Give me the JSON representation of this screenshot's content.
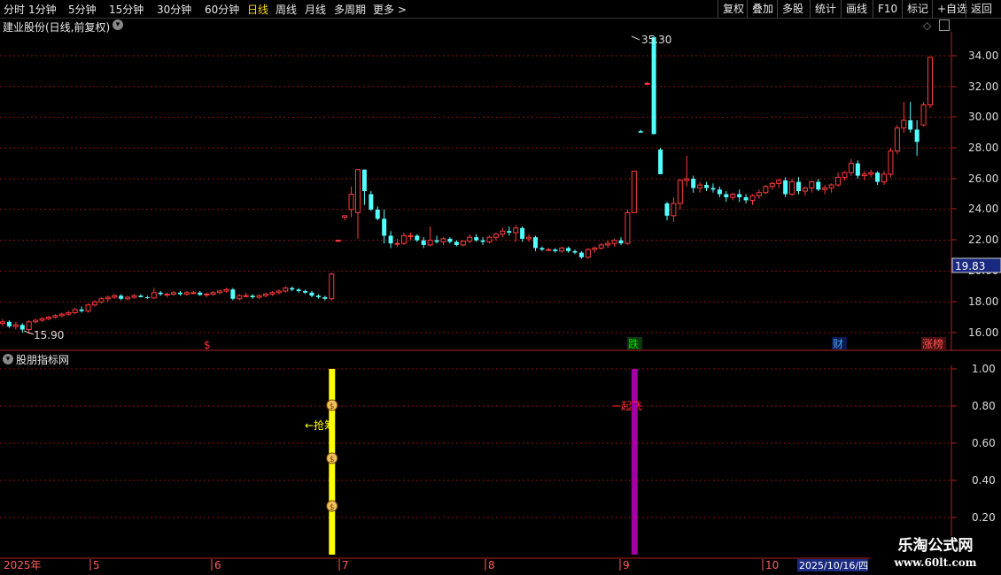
{
  "toolbar": {
    "periods": [
      "分时",
      "1分钟",
      "5分钟",
      "15分钟",
      "30分钟",
      "60分钟",
      "日线",
      "周线",
      "月线",
      "多周期",
      "更多 >"
    ],
    "active_period": "日线",
    "buttons": [
      "复权",
      "叠加",
      "多股",
      "统计",
      "画线",
      "F10",
      "标记",
      "+自选",
      "返回"
    ]
  },
  "header": {
    "title": "建业股份(日线,前复权)"
  },
  "price_axis": {
    "labels": [
      "34.00",
      "32.00",
      "30.00",
      "28.00",
      "26.00",
      "24.00",
      "22.00",
      "20.00",
      "18.00",
      "16.00"
    ],
    "current_price": "19.83"
  },
  "annotations": {
    "high": "35.30",
    "low": "15.90"
  },
  "markers": [
    {
      "text": "$",
      "color": "#ff3030"
    },
    {
      "text": "跌",
      "color": "#00e000"
    },
    {
      "text": "财",
      "color": "#4aa0ff"
    },
    {
      "text": "涨榜",
      "color": "#ff5050"
    }
  ],
  "indicator": {
    "title": "股朋指标网",
    "axis_labels": [
      "1.00",
      "0.80",
      "0.60",
      "0.40",
      "0.20"
    ],
    "signal_yellow": "←抢筹",
    "signal_purple": "起飞"
  },
  "time_axis": {
    "labels": [
      "2025年",
      "5",
      "6",
      "7",
      "8",
      "9",
      "10"
    ],
    "cursor_date": "2025/10/16/四"
  },
  "watermark": {
    "line1": "乐淘公式网",
    "line2": "www.60lt.com"
  },
  "colors": {
    "up": "#ff3b3b",
    "down": "#54ffff",
    "grid": "#8b1010",
    "yellow": "#ffff00",
    "purple": "#a000a0"
  },
  "chart_data": {
    "type": "candlestick",
    "candles": [
      [
        16.6,
        16.9,
        16.4,
        16.7
      ],
      [
        16.7,
        16.8,
        16.3,
        16.4
      ],
      [
        16.4,
        16.7,
        16.2,
        16.5
      ],
      [
        16.5,
        16.6,
        16.0,
        16.2
      ],
      [
        16.2,
        16.8,
        15.9,
        16.7
      ],
      [
        16.7,
        16.9,
        16.6,
        16.8
      ],
      [
        16.8,
        17.0,
        16.7,
        16.9
      ],
      [
        16.9,
        17.1,
        16.8,
        17.0
      ],
      [
        17.0,
        17.2,
        16.9,
        17.1
      ],
      [
        17.1,
        17.3,
        17.0,
        17.2
      ],
      [
        17.2,
        17.4,
        17.1,
        17.3
      ],
      [
        17.3,
        17.6,
        17.2,
        17.5
      ],
      [
        17.5,
        17.7,
        17.3,
        17.4
      ],
      [
        17.4,
        17.9,
        17.3,
        17.8
      ],
      [
        17.8,
        18.1,
        17.7,
        18.0
      ],
      [
        18.0,
        18.3,
        17.9,
        18.2
      ],
      [
        18.2,
        18.4,
        18.0,
        18.3
      ],
      [
        18.3,
        18.5,
        18.2,
        18.4
      ],
      [
        18.4,
        18.5,
        18.1,
        18.2
      ],
      [
        18.2,
        18.4,
        18.1,
        18.3
      ],
      [
        18.3,
        18.5,
        18.2,
        18.4
      ],
      [
        18.4,
        18.5,
        18.3,
        18.3
      ],
      [
        18.3,
        18.4,
        18.2,
        18.25
      ],
      [
        18.25,
        18.9,
        18.2,
        18.6
      ],
      [
        18.6,
        18.7,
        18.4,
        18.5
      ],
      [
        18.5,
        18.6,
        18.3,
        18.5
      ],
      [
        18.5,
        18.7,
        18.4,
        18.6
      ],
      [
        18.6,
        18.7,
        18.4,
        18.5
      ],
      [
        18.5,
        18.7,
        18.4,
        18.6
      ],
      [
        18.6,
        18.7,
        18.5,
        18.6
      ],
      [
        18.6,
        18.7,
        18.4,
        18.45
      ],
      [
        18.45,
        18.6,
        18.3,
        18.5
      ],
      [
        18.5,
        18.7,
        18.4,
        18.6
      ],
      [
        18.6,
        18.8,
        18.5,
        18.7
      ],
      [
        18.7,
        18.9,
        18.6,
        18.8
      ],
      [
        18.8,
        18.9,
        18.1,
        18.2
      ],
      [
        18.2,
        18.5,
        18.1,
        18.4
      ],
      [
        18.4,
        18.6,
        18.3,
        18.4
      ],
      [
        18.4,
        18.5,
        18.2,
        18.3
      ],
      [
        18.3,
        18.5,
        18.2,
        18.4
      ],
      [
        18.4,
        18.6,
        18.3,
        18.5
      ],
      [
        18.5,
        18.7,
        18.4,
        18.6
      ],
      [
        18.6,
        18.8,
        18.5,
        18.7
      ],
      [
        18.7,
        19.0,
        18.6,
        18.9
      ],
      [
        18.9,
        19.0,
        18.7,
        18.8
      ],
      [
        18.8,
        18.9,
        18.6,
        18.7
      ],
      [
        18.7,
        18.8,
        18.5,
        18.6
      ],
      [
        18.6,
        18.7,
        18.3,
        18.4
      ],
      [
        18.4,
        18.5,
        18.2,
        18.3
      ],
      [
        18.3,
        18.4,
        18.1,
        18.2
      ],
      [
        18.2,
        19.9,
        18.1,
        19.8
      ],
      [
        21.95,
        22.05,
        21.9,
        22.0
      ],
      [
        23.5,
        23.6,
        23.3,
        23.6
      ],
      [
        24.0,
        25.5,
        23.5,
        25.0
      ],
      [
        23.8,
        26.6,
        22.1,
        26.6
      ],
      [
        26.6,
        26.6,
        24.3,
        25.2
      ],
      [
        25.0,
        25.2,
        23.9,
        24.0
      ],
      [
        24.0,
        24.2,
        23.3,
        23.4
      ],
      [
        23.4,
        24.0,
        21.8,
        22.3
      ],
      [
        22.3,
        22.6,
        21.5,
        21.8
      ],
      [
        21.8,
        22.1,
        21.6,
        21.8
      ],
      [
        21.8,
        22.5,
        21.7,
        22.3
      ],
      [
        22.3,
        22.5,
        22.0,
        22.3
      ],
      [
        22.3,
        22.4,
        21.9,
        22.0
      ],
      [
        22.0,
        22.2,
        21.5,
        21.7
      ],
      [
        21.7,
        22.9,
        21.6,
        22.0
      ],
      [
        22.0,
        22.3,
        21.8,
        21.9
      ],
      [
        21.9,
        22.2,
        21.7,
        22.1
      ],
      [
        22.1,
        22.2,
        21.8,
        21.9
      ],
      [
        21.9,
        22.0,
        21.6,
        21.7
      ],
      [
        21.7,
        22.0,
        21.6,
        21.95
      ],
      [
        21.95,
        22.4,
        21.8,
        22.2
      ],
      [
        22.2,
        22.4,
        21.9,
        22.0
      ],
      [
        22.0,
        22.2,
        21.7,
        21.9
      ],
      [
        21.9,
        22.3,
        21.8,
        22.2
      ],
      [
        22.2,
        22.5,
        22.0,
        22.4
      ],
      [
        22.4,
        22.8,
        22.2,
        22.6
      ],
      [
        22.6,
        22.9,
        22.3,
        22.5
      ],
      [
        22.5,
        23.0,
        21.9,
        22.8
      ],
      [
        22.8,
        22.9,
        21.9,
        22.1
      ],
      [
        22.1,
        22.4,
        21.9,
        22.2
      ],
      [
        22.2,
        22.3,
        21.3,
        21.5
      ],
      [
        21.5,
        21.6,
        21.3,
        21.4
      ],
      [
        21.4,
        21.5,
        21.3,
        21.4
      ],
      [
        21.4,
        21.5,
        21.2,
        21.3
      ],
      [
        21.3,
        21.6,
        21.2,
        21.5
      ],
      [
        21.5,
        21.6,
        21.2,
        21.3
      ],
      [
        21.3,
        21.4,
        21.1,
        21.2
      ],
      [
        21.2,
        21.3,
        20.8,
        20.9
      ],
      [
        20.9,
        21.5,
        20.8,
        21.4
      ],
      [
        21.4,
        21.6,
        21.2,
        21.5
      ],
      [
        21.5,
        21.8,
        21.4,
        21.7
      ],
      [
        21.7,
        22.0,
        21.5,
        21.8
      ],
      [
        21.8,
        22.1,
        21.6,
        22.0
      ],
      [
        22.0,
        22.2,
        21.7,
        21.8
      ],
      [
        21.8,
        24.0,
        21.7,
        23.8
      ],
      [
        23.8,
        26.5,
        23.8,
        26.5
      ],
      [
        29.1,
        29.2,
        29.0,
        29.0
      ],
      [
        32.2,
        32.3,
        32.1,
        32.2
      ],
      [
        35.2,
        35.3,
        28.9,
        28.9
      ],
      [
        27.9,
        28.0,
        26.3,
        26.3
      ],
      [
        24.4,
        24.5,
        23.3,
        23.6
      ],
      [
        23.6,
        24.8,
        23.2,
        24.4
      ],
      [
        24.4,
        26.0,
        24.0,
        25.9
      ],
      [
        25.9,
        27.5,
        25.5,
        26.0
      ],
      [
        26.0,
        26.2,
        25.1,
        25.4
      ],
      [
        25.4,
        25.8,
        25.1,
        25.6
      ],
      [
        25.6,
        25.8,
        25.2,
        25.4
      ],
      [
        25.4,
        25.7,
        25.1,
        25.3
      ],
      [
        25.3,
        25.5,
        24.8,
        25.0
      ],
      [
        25.0,
        25.2,
        24.5,
        24.8
      ],
      [
        24.8,
        25.1,
        24.6,
        25.0
      ],
      [
        25.0,
        25.3,
        24.5,
        24.8
      ],
      [
        24.8,
        25.0,
        24.4,
        24.6
      ],
      [
        24.6,
        25.0,
        24.3,
        24.9
      ],
      [
        24.9,
        25.3,
        24.7,
        25.1
      ],
      [
        25.1,
        25.6,
        25.0,
        25.5
      ],
      [
        25.5,
        25.8,
        25.3,
        25.7
      ],
      [
        25.7,
        26.0,
        25.4,
        25.9
      ],
      [
        25.9,
        26.1,
        24.8,
        25.0
      ],
      [
        25.0,
        26.0,
        24.9,
        25.8
      ],
      [
        25.8,
        26.1,
        25.0,
        25.2
      ],
      [
        25.2,
        25.5,
        24.9,
        25.4
      ],
      [
        25.4,
        25.9,
        25.1,
        25.8
      ],
      [
        25.8,
        26.0,
        25.2,
        25.3
      ],
      [
        25.3,
        25.6,
        25.0,
        25.4
      ],
      [
        25.4,
        25.7,
        25.1,
        25.6
      ],
      [
        25.6,
        26.4,
        25.5,
        26.1
      ],
      [
        26.1,
        26.5,
        25.9,
        26.4
      ],
      [
        26.4,
        27.3,
        26.2,
        27.0
      ],
      [
        27.0,
        27.2,
        26.0,
        26.2
      ],
      [
        26.2,
        26.5,
        25.9,
        26.3
      ],
      [
        26.3,
        26.6,
        26.1,
        26.4
      ],
      [
        26.4,
        26.5,
        25.6,
        25.8
      ],
      [
        25.8,
        26.5,
        25.6,
        26.3
      ],
      [
        26.3,
        28.0,
        26.1,
        27.8
      ],
      [
        27.8,
        29.5,
        27.6,
        29.3
      ],
      [
        29.3,
        31.0,
        29.0,
        29.8
      ],
      [
        29.8,
        31.0,
        29.0,
        29.2
      ],
      [
        29.2,
        29.8,
        27.5,
        28.4
      ],
      [
        29.5,
        31.0,
        29.4,
        30.8
      ],
      [
        30.8,
        33.9,
        30.6,
        33.9
      ]
    ],
    "indicator_signals": [
      {
        "type": "yellow",
        "candle_index": 50,
        "label": "←抢筹"
      },
      {
        "type": "purple",
        "candle_index": 96,
        "label": "起飞"
      }
    ],
    "price_range": [
      15.0,
      36.5
    ],
    "indicator_range": [
      0.1,
      1.1
    ],
    "xlabels": [
      "2025年",
      "5",
      "6",
      "7",
      "8",
      "9",
      "10"
    ]
  }
}
